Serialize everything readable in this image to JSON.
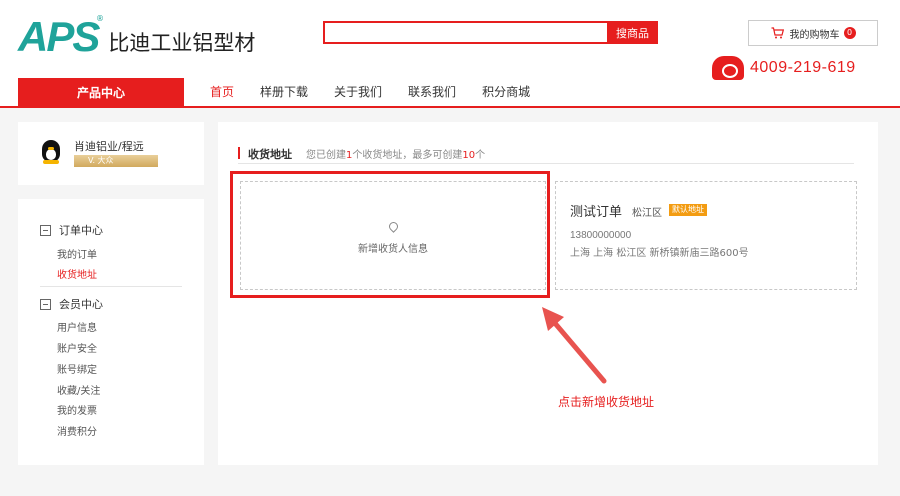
{
  "brand": {
    "logo": "APS",
    "reg": "®",
    "name": "比迪工业铝型材"
  },
  "search": {
    "placeholder": "",
    "button": "搜商品"
  },
  "cart": {
    "label": "我的购物车",
    "count": "0"
  },
  "phone": "4009-219-619",
  "nav": {
    "category": "产品中心",
    "items": [
      "首页",
      "样册下载",
      "关于我们",
      "联系我们",
      "积分商城"
    ]
  },
  "user": {
    "name": "肖迪铝业/程远",
    "level": "V. 大众"
  },
  "sidebar": {
    "order_center": "订单中心",
    "my_orders": "我的订单",
    "shipping_address": "收货地址",
    "member_center": "会员中心",
    "member_links": [
      "用户信息",
      "账户安全",
      "账号绑定",
      "收藏/关注",
      "我的发票",
      "消费积分"
    ]
  },
  "main": {
    "title": "收货地址",
    "note_prefix": "您已创建",
    "created": "1",
    "note_mid": "个收货地址，最多可创建",
    "max": "10",
    "note_suffix": "个",
    "add_label": "新增收货人信息"
  },
  "address": {
    "name": "测试订单",
    "district": "松江区",
    "default_tag": "默认地址",
    "phone": "13800000000",
    "full": "上海 上海 松江区  新桥镇新庙三路600号"
  },
  "annotation": "点击新增收货地址",
  "colors": {
    "accent": "#e61e1e",
    "brand_teal": "#1fa39a",
    "default_tag": "#f39c12"
  }
}
